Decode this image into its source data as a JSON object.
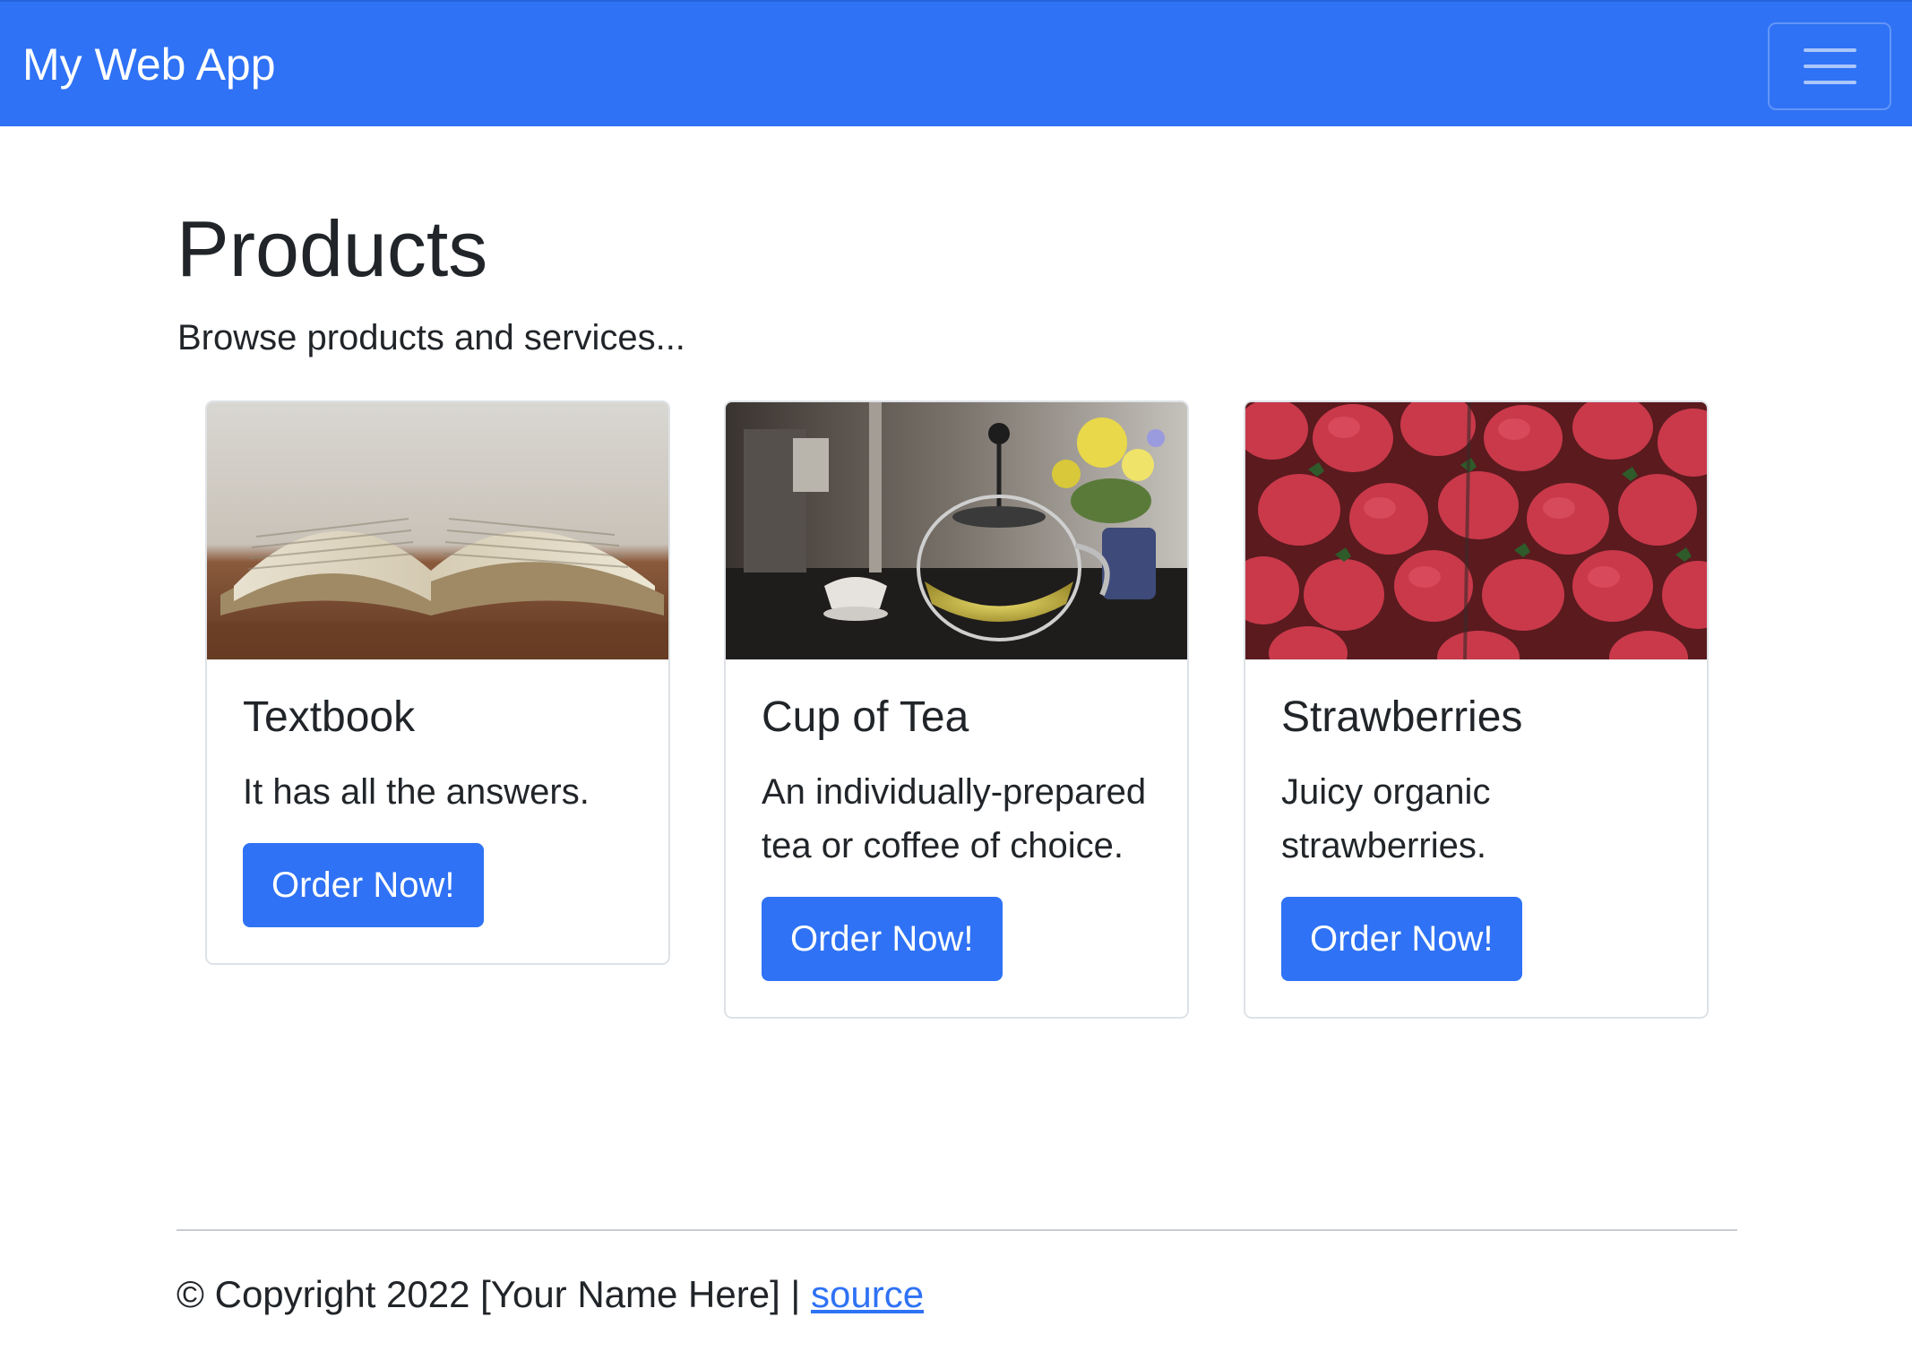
{
  "navbar": {
    "brand": "My Web App",
    "toggler_icon": "hamburger-menu-icon",
    "color": "#2f72f5"
  },
  "main": {
    "title": "Products",
    "intro": "Browse products and services..."
  },
  "products": [
    {
      "title": "Textbook",
      "description": "It has all the answers.",
      "button_label": "Order Now!",
      "image": "open-book-photo"
    },
    {
      "title": "Cup of Tea",
      "description": "An individually-prepared tea or coffee of choice.",
      "button_label": "Order Now!",
      "image": "teapot-photo"
    },
    {
      "title": "Strawberries",
      "description": "Juicy organic strawberries.",
      "button_label": "Order Now!",
      "image": "strawberries-photo"
    }
  ],
  "footer": {
    "copyright": "© Copyright 2022 [Your Name Here] | ",
    "source_link": "source"
  },
  "colors": {
    "accent": "#2f72f5",
    "text": "#212529",
    "border": "#dee2e6"
  }
}
